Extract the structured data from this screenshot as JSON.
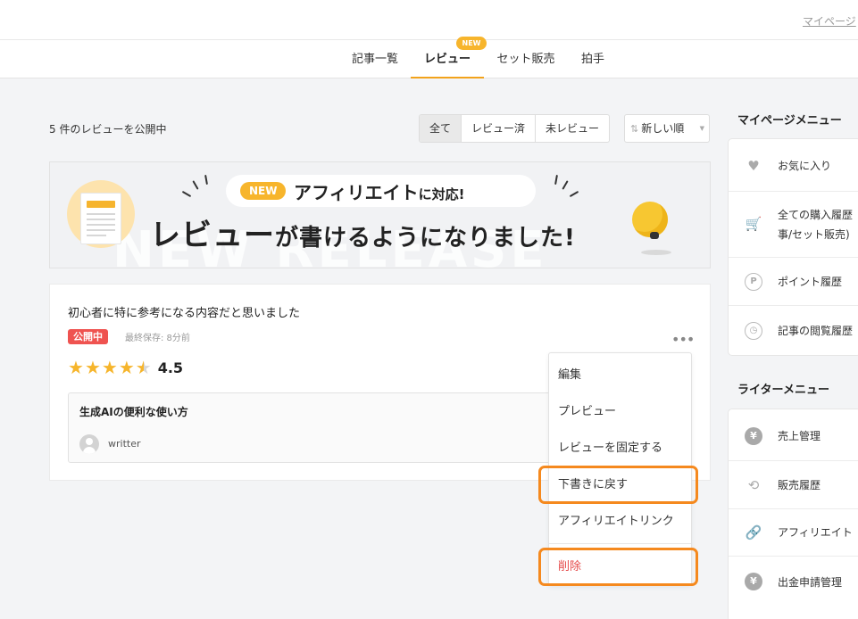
{
  "header": {
    "mypage_link": "マイページ"
  },
  "tabs": [
    {
      "label": "記事一覧",
      "active": false
    },
    {
      "label": "レビュー",
      "active": true,
      "badge": "NEW"
    },
    {
      "label": "セット販売",
      "active": false
    },
    {
      "label": "拍手",
      "active": false
    }
  ],
  "toolbar": {
    "count_text": "5 件のレビューを公開中",
    "filters": [
      "全て",
      "レビュー済",
      "未レビュー"
    ],
    "active_filter": "全て",
    "sort_label": "新しい順"
  },
  "banner": {
    "badge": "NEW",
    "line1_main": "アフィリエイト",
    "line1_suffix": "に対応!",
    "headline_main": "レビュー",
    "headline_suffix": "が書けるようになりました!",
    "watermark": "NEW RELEASE"
  },
  "review": {
    "title": "初心者に特に参考になる内容だと思いました",
    "status": "公開中",
    "saved": "最終保存: 8分前",
    "rating": 4.5,
    "rating_text": "4.5",
    "article": {
      "title": "生成AIの便利な使い方",
      "author": "writter"
    }
  },
  "menu": {
    "items": [
      "編集",
      "プレビュー",
      "レビューを固定する",
      "下書きに戻す",
      "アフィリエイトリンク"
    ],
    "delete_label": "削除",
    "highlighted": [
      "下書きに戻す",
      "削除"
    ]
  },
  "sidebar": {
    "mypage_title": "マイページメニュー",
    "mypage_items": [
      {
        "label": "お気に入り",
        "icon": "heart-icon"
      },
      {
        "label": "全ての購入履歴",
        "label2": "事/セット販売)",
        "icon": "cart-icon"
      },
      {
        "label": "ポイント履歴",
        "icon": "point-icon"
      },
      {
        "label": "記事の閲覧履歴",
        "icon": "clock-icon"
      }
    ],
    "writer_title": "ライターメニュー",
    "writer_items": [
      {
        "label": "売上管理",
        "icon": "yen-icon"
      },
      {
        "label": "販売履歴",
        "icon": "sales-history-icon"
      },
      {
        "label": "アフィリエイト",
        "icon": "link-icon"
      },
      {
        "label": "出金申請管理",
        "icon": "withdraw-icon"
      }
    ]
  },
  "colors": {
    "accent": "#f7b52c",
    "status_public": "#ef5350",
    "danger": "#e54b4b",
    "highlight": "#f5891e"
  }
}
